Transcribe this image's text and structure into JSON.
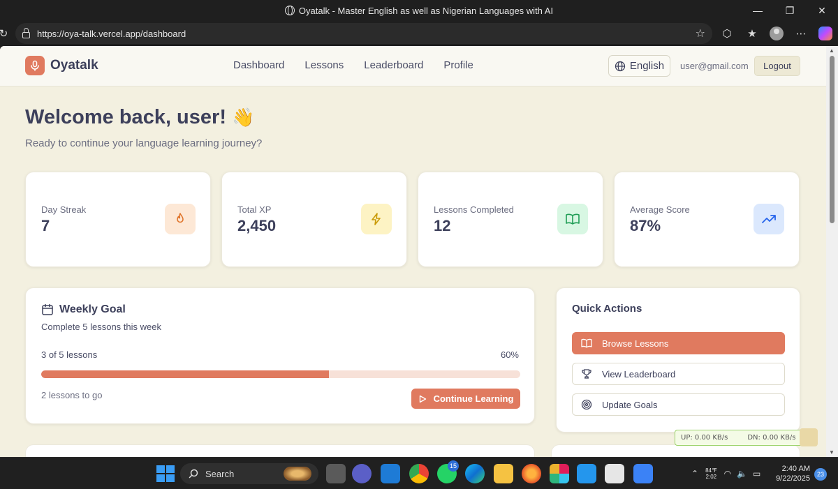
{
  "browser": {
    "window_title": "Oyatalk - Master English as well as Nigerian Languages with AI",
    "url": "https://oya-talk.vercel.app/dashboard",
    "controls": {
      "minimize": "—",
      "restore": "❐",
      "close": "✕"
    }
  },
  "header": {
    "brand": "Oyatalk",
    "nav": [
      "Dashboard",
      "Lessons",
      "Leaderboard",
      "Profile"
    ],
    "language": "English",
    "email": "user@gmail.com",
    "logout": "Logout"
  },
  "welcome": {
    "title": "Welcome back, user!",
    "emoji": "👋",
    "subtitle": "Ready to continue your language learning journey?"
  },
  "stats": [
    {
      "label": "Day Streak",
      "value": "7",
      "icon": "flame-icon",
      "bg": "#fde8d6",
      "color": "#e0742a"
    },
    {
      "label": "Total XP",
      "value": "2,450",
      "icon": "lightning-icon",
      "bg": "#fdf3c4",
      "color": "#c99a06"
    },
    {
      "label": "Lessons Completed",
      "value": "12",
      "icon": "book-open-icon",
      "bg": "#d8f7e3",
      "color": "#1f9d55"
    },
    {
      "label": "Average Score",
      "value": "87%",
      "icon": "trending-up-icon",
      "bg": "#dbe8fd",
      "color": "#2563eb"
    }
  ],
  "weekly_goal": {
    "title": "Weekly Goal",
    "description": "Complete 5 lessons this week",
    "progress_label": "3 of 5 lessons",
    "percent_label": "60%",
    "progress": 0.6,
    "remaining": "2 lessons to go",
    "button": "Continue Learning"
  },
  "quick_actions": {
    "title": "Quick Actions",
    "items": [
      {
        "label": "Browse Lessons",
        "icon": "book-open-icon"
      },
      {
        "label": "View Leaderboard",
        "icon": "trophy-icon"
      },
      {
        "label": "Update Goals",
        "icon": "target-icon"
      }
    ]
  },
  "net_meter": {
    "up": "UP: 0.00 KB/s",
    "down": "DN: 0.00 KB/s"
  },
  "taskbar": {
    "search": "Search",
    "whatsapp_badge": "15",
    "tray_temp": "84℉",
    "tray_time_small": "2:02",
    "time": "2:40 AM",
    "date": "9/22/2025",
    "notifications": "23"
  },
  "colors": {
    "accent": "#e07a5f",
    "background": "#f3f0e0",
    "text": "#3d405b"
  }
}
